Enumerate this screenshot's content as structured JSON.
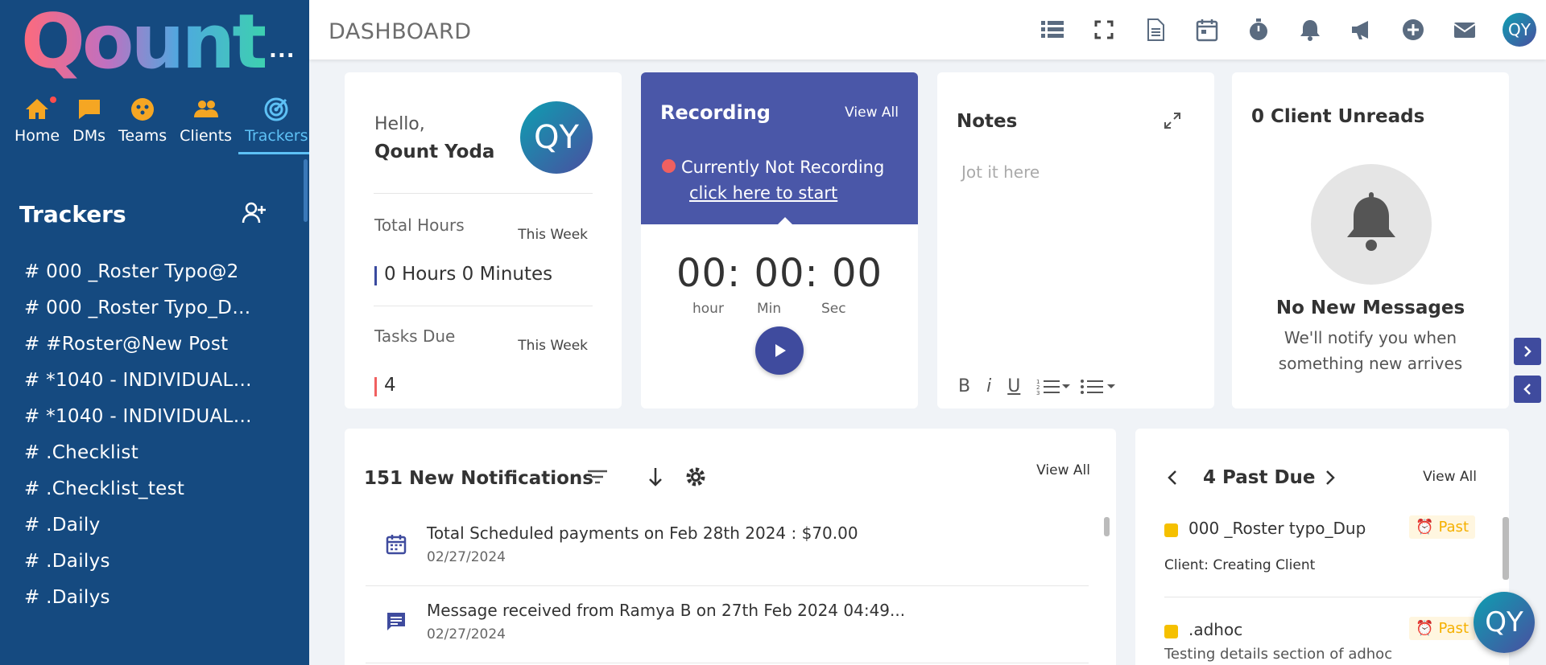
{
  "app": {
    "logo_text": "Qount",
    "more_label": "..."
  },
  "nav": [
    {
      "label": "Home",
      "icon": "home-icon"
    },
    {
      "label": "DMs",
      "icon": "chat-icon"
    },
    {
      "label": "Teams",
      "icon": "teams-icon"
    },
    {
      "label": "Clients",
      "icon": "clients-icon"
    },
    {
      "label": "Trackers",
      "icon": "trackers-icon",
      "active": true
    }
  ],
  "sidebar": {
    "title": "Trackers",
    "items": [
      "# 000 _Roster Typo@2",
      "# 000 _Roster Typo_D…",
      "# #Roster@New Post",
      "# *1040 - INDIVIDUAL I…",
      "# *1040 - INDIVIDUAL I…",
      "# .Checklist",
      "# .Checklist_test",
      "# .Daily",
      "# .Dailys",
      "# .Dailys"
    ]
  },
  "topbar": {
    "title": "DASHBOARD",
    "avatar": "QY"
  },
  "hello": {
    "greeting": "Hello,",
    "name": "Qount Yoda",
    "avatar": "QY",
    "total_hours_label": "Total Hours",
    "total_hours_period": "This Week",
    "total_hours_value": "0 Hours 0 Minutes",
    "tasks_due_label": "Tasks Due",
    "tasks_due_period": "This Week",
    "tasks_due_value": "4"
  },
  "recording": {
    "title": "Recording",
    "view_all": "View All",
    "status": "Currently Not Recording",
    "start_link": "click here to start",
    "timer": "00: 00: 00",
    "hour_label": "hour",
    "min_label": "Min",
    "sec_label": "Sec"
  },
  "notes": {
    "title": "Notes",
    "placeholder": "Jot it here",
    "bold": "B",
    "italic": "i",
    "underline": "U"
  },
  "unreads": {
    "title": "0 Client Unreads",
    "empty_title": "No New Messages",
    "empty_sub": "We'll notify you when something new arrives"
  },
  "notifications": {
    "title": "151 New Notifications",
    "view_all": "View All",
    "items": [
      {
        "text": "Total Scheduled payments on Feb 28th 2024 : $70.00",
        "date": "02/27/2024",
        "icon": "calendar-icon"
      },
      {
        "text": "Message received from Ramya B on 27th Feb 2024 04:49...",
        "date": "02/27/2024",
        "icon": "message-icon"
      }
    ]
  },
  "past_due": {
    "title": "4 Past Due",
    "view_all": "View All",
    "items": [
      {
        "name": "000 _Roster typo_Dup",
        "badge": "Past",
        "client": "Client: Creating Client"
      },
      {
        "name": ".adhoc",
        "badge": "Past",
        "desc": "Testing details section of adhoc"
      }
    ]
  },
  "floating_avatar": "QY",
  "colors": {
    "sidebar": "#154a80",
    "accent": "#4a57a8",
    "active_nav": "#5ec1f5",
    "badge": "#f5b000"
  }
}
